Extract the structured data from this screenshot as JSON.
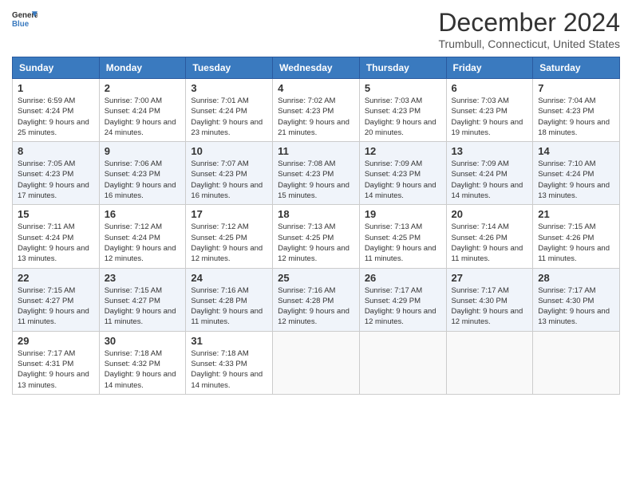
{
  "header": {
    "logo_line1": "General",
    "logo_line2": "Blue",
    "title": "December 2024",
    "subtitle": "Trumbull, Connecticut, United States"
  },
  "columns": [
    "Sunday",
    "Monday",
    "Tuesday",
    "Wednesday",
    "Thursday",
    "Friday",
    "Saturday"
  ],
  "weeks": [
    [
      {
        "day": "1",
        "sunrise": "Sunrise: 6:59 AM",
        "sunset": "Sunset: 4:24 PM",
        "daylight": "Daylight: 9 hours and 25 minutes."
      },
      {
        "day": "2",
        "sunrise": "Sunrise: 7:00 AM",
        "sunset": "Sunset: 4:24 PM",
        "daylight": "Daylight: 9 hours and 24 minutes."
      },
      {
        "day": "3",
        "sunrise": "Sunrise: 7:01 AM",
        "sunset": "Sunset: 4:24 PM",
        "daylight": "Daylight: 9 hours and 23 minutes."
      },
      {
        "day": "4",
        "sunrise": "Sunrise: 7:02 AM",
        "sunset": "Sunset: 4:23 PM",
        "daylight": "Daylight: 9 hours and 21 minutes."
      },
      {
        "day": "5",
        "sunrise": "Sunrise: 7:03 AM",
        "sunset": "Sunset: 4:23 PM",
        "daylight": "Daylight: 9 hours and 20 minutes."
      },
      {
        "day": "6",
        "sunrise": "Sunrise: 7:03 AM",
        "sunset": "Sunset: 4:23 PM",
        "daylight": "Daylight: 9 hours and 19 minutes."
      },
      {
        "day": "7",
        "sunrise": "Sunrise: 7:04 AM",
        "sunset": "Sunset: 4:23 PM",
        "daylight": "Daylight: 9 hours and 18 minutes."
      }
    ],
    [
      {
        "day": "8",
        "sunrise": "Sunrise: 7:05 AM",
        "sunset": "Sunset: 4:23 PM",
        "daylight": "Daylight: 9 hours and 17 minutes."
      },
      {
        "day": "9",
        "sunrise": "Sunrise: 7:06 AM",
        "sunset": "Sunset: 4:23 PM",
        "daylight": "Daylight: 9 hours and 16 minutes."
      },
      {
        "day": "10",
        "sunrise": "Sunrise: 7:07 AM",
        "sunset": "Sunset: 4:23 PM",
        "daylight": "Daylight: 9 hours and 16 minutes."
      },
      {
        "day": "11",
        "sunrise": "Sunrise: 7:08 AM",
        "sunset": "Sunset: 4:23 PM",
        "daylight": "Daylight: 9 hours and 15 minutes."
      },
      {
        "day": "12",
        "sunrise": "Sunrise: 7:09 AM",
        "sunset": "Sunset: 4:23 PM",
        "daylight": "Daylight: 9 hours and 14 minutes."
      },
      {
        "day": "13",
        "sunrise": "Sunrise: 7:09 AM",
        "sunset": "Sunset: 4:24 PM",
        "daylight": "Daylight: 9 hours and 14 minutes."
      },
      {
        "day": "14",
        "sunrise": "Sunrise: 7:10 AM",
        "sunset": "Sunset: 4:24 PM",
        "daylight": "Daylight: 9 hours and 13 minutes."
      }
    ],
    [
      {
        "day": "15",
        "sunrise": "Sunrise: 7:11 AM",
        "sunset": "Sunset: 4:24 PM",
        "daylight": "Daylight: 9 hours and 13 minutes."
      },
      {
        "day": "16",
        "sunrise": "Sunrise: 7:12 AM",
        "sunset": "Sunset: 4:24 PM",
        "daylight": "Daylight: 9 hours and 12 minutes."
      },
      {
        "day": "17",
        "sunrise": "Sunrise: 7:12 AM",
        "sunset": "Sunset: 4:25 PM",
        "daylight": "Daylight: 9 hours and 12 minutes."
      },
      {
        "day": "18",
        "sunrise": "Sunrise: 7:13 AM",
        "sunset": "Sunset: 4:25 PM",
        "daylight": "Daylight: 9 hours and 12 minutes."
      },
      {
        "day": "19",
        "sunrise": "Sunrise: 7:13 AM",
        "sunset": "Sunset: 4:25 PM",
        "daylight": "Daylight: 9 hours and 11 minutes."
      },
      {
        "day": "20",
        "sunrise": "Sunrise: 7:14 AM",
        "sunset": "Sunset: 4:26 PM",
        "daylight": "Daylight: 9 hours and 11 minutes."
      },
      {
        "day": "21",
        "sunrise": "Sunrise: 7:15 AM",
        "sunset": "Sunset: 4:26 PM",
        "daylight": "Daylight: 9 hours and 11 minutes."
      }
    ],
    [
      {
        "day": "22",
        "sunrise": "Sunrise: 7:15 AM",
        "sunset": "Sunset: 4:27 PM",
        "daylight": "Daylight: 9 hours and 11 minutes."
      },
      {
        "day": "23",
        "sunrise": "Sunrise: 7:15 AM",
        "sunset": "Sunset: 4:27 PM",
        "daylight": "Daylight: 9 hours and 11 minutes."
      },
      {
        "day": "24",
        "sunrise": "Sunrise: 7:16 AM",
        "sunset": "Sunset: 4:28 PM",
        "daylight": "Daylight: 9 hours and 11 minutes."
      },
      {
        "day": "25",
        "sunrise": "Sunrise: 7:16 AM",
        "sunset": "Sunset: 4:28 PM",
        "daylight": "Daylight: 9 hours and 12 minutes."
      },
      {
        "day": "26",
        "sunrise": "Sunrise: 7:17 AM",
        "sunset": "Sunset: 4:29 PM",
        "daylight": "Daylight: 9 hours and 12 minutes."
      },
      {
        "day": "27",
        "sunrise": "Sunrise: 7:17 AM",
        "sunset": "Sunset: 4:30 PM",
        "daylight": "Daylight: 9 hours and 12 minutes."
      },
      {
        "day": "28",
        "sunrise": "Sunrise: 7:17 AM",
        "sunset": "Sunset: 4:30 PM",
        "daylight": "Daylight: 9 hours and 13 minutes."
      }
    ],
    [
      {
        "day": "29",
        "sunrise": "Sunrise: 7:17 AM",
        "sunset": "Sunset: 4:31 PM",
        "daylight": "Daylight: 9 hours and 13 minutes."
      },
      {
        "day": "30",
        "sunrise": "Sunrise: 7:18 AM",
        "sunset": "Sunset: 4:32 PM",
        "daylight": "Daylight: 9 hours and 14 minutes."
      },
      {
        "day": "31",
        "sunrise": "Sunrise: 7:18 AM",
        "sunset": "Sunset: 4:33 PM",
        "daylight": "Daylight: 9 hours and 14 minutes."
      },
      null,
      null,
      null,
      null
    ]
  ]
}
